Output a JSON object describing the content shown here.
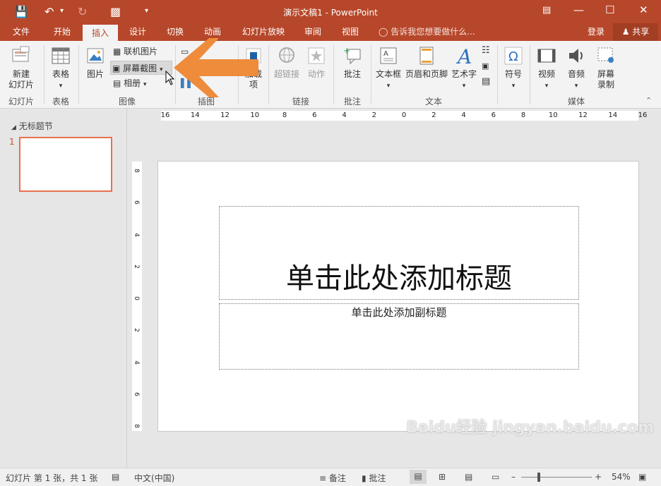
{
  "window": {
    "title": "演示文稿1 - PowerPoint"
  },
  "tabs": [
    "文件",
    "开始",
    "插入",
    "设计",
    "切换",
    "动画",
    "幻灯片放映",
    "审阅",
    "视图"
  ],
  "tell_me": "告诉我您想要做什么...",
  "account": {
    "login": "登录",
    "share": "共享"
  },
  "ribbon": {
    "new_slide": "新建\n幻灯片",
    "table": "表格",
    "picture": "图片",
    "online_picture": "联机图片",
    "screenshot": "屏幕截图",
    "album": "相册",
    "addins": "加载\n项",
    "link": "超链接",
    "action": "动作",
    "comment": "批注",
    "textbox": "文本框",
    "header_footer": "页眉和页脚",
    "wordart": "艺术字",
    "symbol": "符号",
    "video": "视频",
    "audio": "音频",
    "screen_record": "屏幕\n录制",
    "groups": {
      "slides": "幻灯片",
      "tables": "表格",
      "images": "图像",
      "illustrations": "插图",
      "links": "链接",
      "comments": "批注",
      "text": "文本",
      "media": "媒体"
    }
  },
  "thumbnails": {
    "section": "无标题节",
    "slide_number": "1"
  },
  "ruler": {
    "h_labels": [
      "16",
      "14",
      "12",
      "10",
      "8",
      "6",
      "4",
      "2",
      "0",
      "2",
      "4",
      "6",
      "8",
      "10",
      "12",
      "14",
      "16"
    ],
    "v_labels": [
      "8",
      "6",
      "4",
      "2",
      "0",
      "2",
      "4",
      "6",
      "8"
    ]
  },
  "slide": {
    "title_placeholder": "单击此处添加标题",
    "subtitle_placeholder": "单击此处添加副标题"
  },
  "status": {
    "slide_info": "幻灯片 第 1 张，共 1 张",
    "language": "中文(中国)",
    "notes": "备注",
    "comments": "批注",
    "zoom": "54%"
  },
  "watermark": "Baidu经验 jingyan.baidu.com",
  "colors": {
    "accent": "#b7472a",
    "arrow": "#ee8c3c",
    "thumb_border": "#e8704f"
  }
}
